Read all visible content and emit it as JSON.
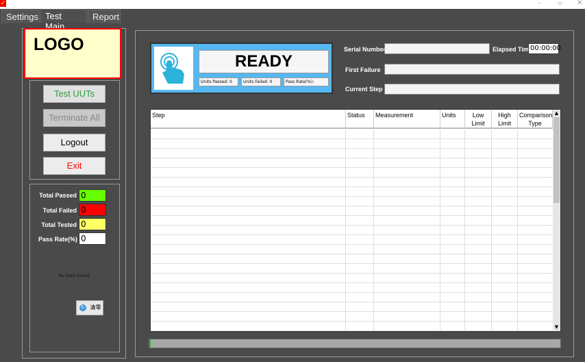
{
  "window": {
    "icon": "checkmark-icon"
  },
  "tabs": [
    {
      "label": "Settings"
    },
    {
      "label": "Test Main",
      "active": true
    },
    {
      "label": "Report"
    }
  ],
  "logo": {
    "text": "LOGO"
  },
  "buttons": {
    "test_uuts": "Test UUTs",
    "terminate_all": "Terminate All",
    "logout": "Logout",
    "exit": "Exit"
  },
  "stats": {
    "total_passed_label": "Total Passed",
    "total_passed": "0",
    "total_failed_label": "Total Failed",
    "total_failed": "0",
    "total_tested_label": "Total Tested",
    "total_tested": "0",
    "pass_rate_label": "Pass Rate(%)",
    "pass_rate": "0",
    "no_data": "No Data Found",
    "clear_label": "清零"
  },
  "status": {
    "text": "READY",
    "units_passed": "Units Passed: 0",
    "units_failed": "Units Failed: 0",
    "pass_rate": "Pass Rate(%):",
    "icon": "touch-hand-icon"
  },
  "fields": {
    "serial_number_label": "Serial Number",
    "serial_number": "",
    "elapsed_time_label": "Elapsed Time",
    "elapsed_time": "00:00:00",
    "first_failure_label": "First Failure",
    "first_failure": "",
    "current_step_label": "Current Step",
    "current_step": ""
  },
  "table": {
    "columns": [
      "Step",
      "Status",
      "Measurement",
      "Units",
      "Low Limit",
      "High Limit",
      "Comparison Type"
    ],
    "rows": []
  },
  "progress": {
    "value": 0
  },
  "colors": {
    "passed": "#66ff00",
    "failed": "#ff0000",
    "tested": "#ffff66",
    "status_frame": "#55b8f0",
    "logo_bg": "#ffffcc",
    "logo_border": "#ff0000",
    "exit_text": "#ff0000",
    "test_uuts_text": "#2e9e3e"
  }
}
